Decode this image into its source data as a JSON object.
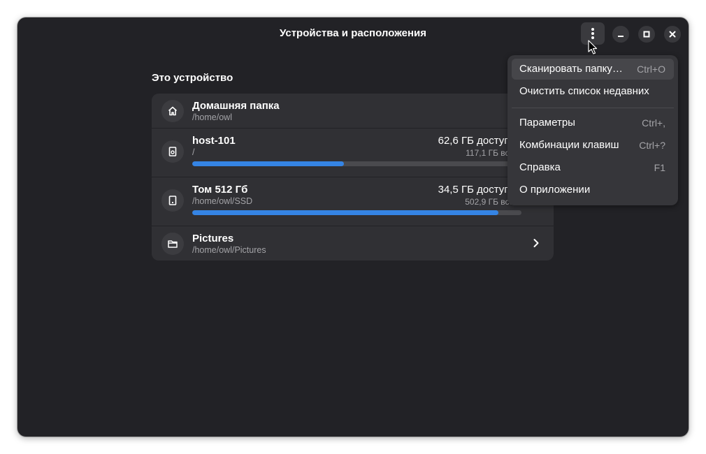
{
  "window": {
    "title": "Устройства и расположения"
  },
  "section": {
    "title": "Это устройство"
  },
  "places": [
    {
      "name": "Домашняя папка",
      "path": "/home/owl"
    },
    {
      "name": "host-101",
      "path": "/",
      "free": "62,6 ГБ доступно",
      "total": "117,1 ГБ всего",
      "usage_fraction": 0.46
    },
    {
      "name": "Том 512 Гб",
      "path": "/home/owl/SSD",
      "free": "34,5 ГБ доступно",
      "total": "502,9 ГБ всего",
      "usage_fraction": 0.93
    },
    {
      "name": "Pictures",
      "path": "/home/owl/Pictures"
    }
  ],
  "menu": {
    "items": [
      {
        "label": "Сканировать папку…",
        "accel": "Ctrl+O"
      },
      {
        "label": "Очистить список недавних",
        "accel": ""
      },
      {
        "label": "Параметры",
        "accel": "Ctrl+,"
      },
      {
        "label": "Комбинации клавиш",
        "accel": "Ctrl+?"
      },
      {
        "label": "Справка",
        "accel": "F1"
      },
      {
        "label": "О приложении",
        "accel": ""
      }
    ]
  },
  "colors": {
    "accent": "#3584e4",
    "window_bg": "#222226",
    "card_bg": "#303034"
  },
  "icons": {
    "menu": "vertical-dots-icon",
    "minimize": "minimize-icon",
    "maximize": "maximize-icon",
    "close": "close-icon",
    "home": "home-icon",
    "drive": "drive-icon",
    "volume": "volume-icon",
    "folder": "folder-icon",
    "chevron": "chevron-right-icon"
  }
}
